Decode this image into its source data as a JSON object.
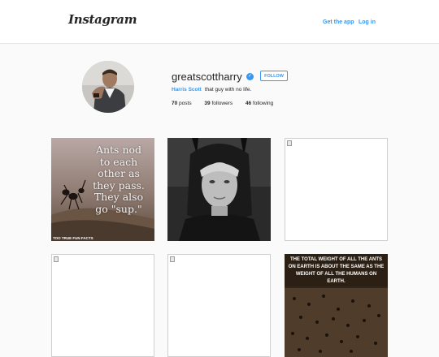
{
  "header": {
    "logo": "Instagram",
    "get_app": "Get the app",
    "login": "Log in"
  },
  "profile": {
    "username": "greatscottharry",
    "verified_icon": "✓",
    "follow_label": "FOLLOW",
    "full_name": "Harris Scott",
    "bio": "that guy with no life.",
    "stats": [
      {
        "count": "70",
        "label": "posts"
      },
      {
        "count": "39",
        "label": "followers"
      },
      {
        "count": "46",
        "label": "following"
      }
    ]
  },
  "posts": {
    "ants_quote": "Ants nod to each other as they pass. They also go \"sup.\"",
    "ants_footer": "TOO TRUE FUN FACTS",
    "weight_fact": "The total weight of all the ants on earth is about the same as the weight of all the humans on earth."
  },
  "colors": {
    "accent": "#3897f0",
    "text": "#262626",
    "background": "#fafafa"
  }
}
